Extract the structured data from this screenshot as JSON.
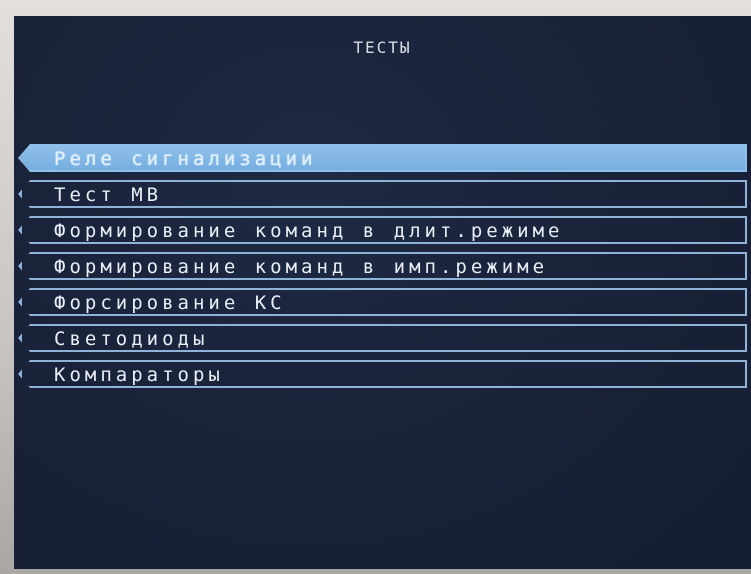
{
  "screen": {
    "title": "ТЕСТЫ"
  },
  "menu": {
    "items": [
      {
        "label": "Реле сигнализации",
        "selected": true
      },
      {
        "label": "Тест МВ",
        "selected": false
      },
      {
        "label": "Формирование команд в длит.режиме",
        "selected": false
      },
      {
        "label": "Формирование команд в имп.режиме",
        "selected": false
      },
      {
        "label": "Форсирование КС",
        "selected": false
      },
      {
        "label": "Светодиоды",
        "selected": false
      },
      {
        "label": "Компараторы",
        "selected": false
      }
    ]
  },
  "colors": {
    "background": "#19233a",
    "selected": "#8fc0ea",
    "border": "#8fb2d6",
    "text": "#e9eef6"
  }
}
